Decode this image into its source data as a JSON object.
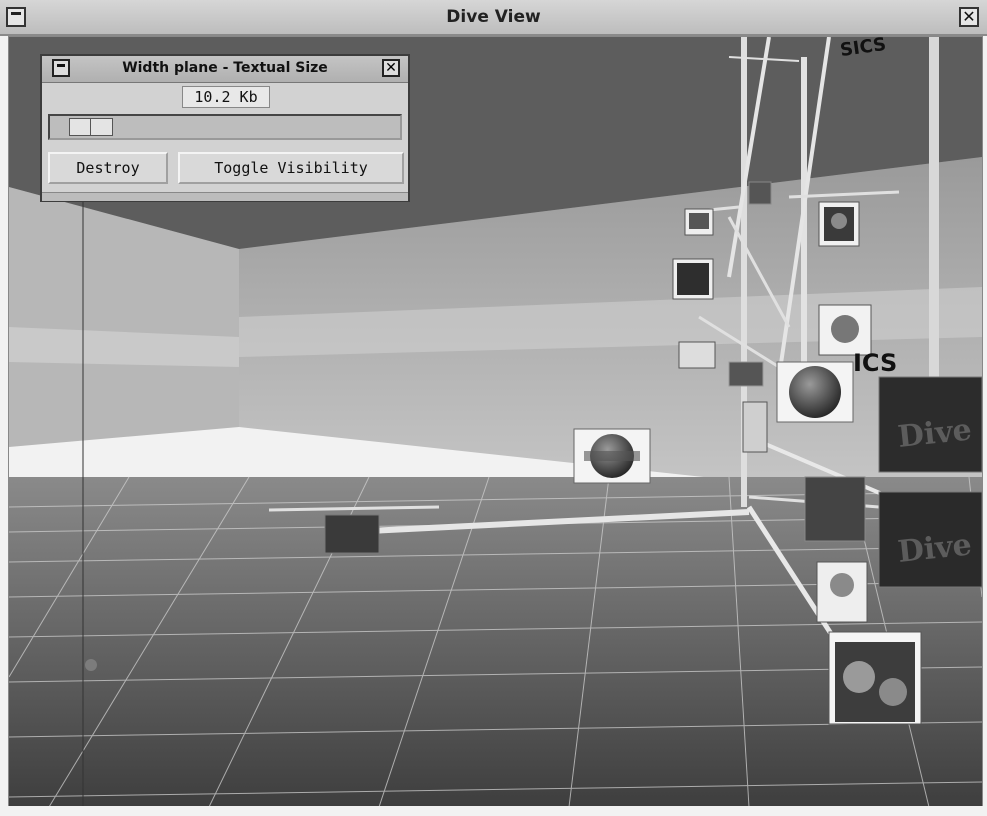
{
  "window": {
    "title": "Dive View",
    "close_glyph": "✕"
  },
  "dialog": {
    "title": "Width plane - Textual Size",
    "value": "10.2 Kb",
    "slider_level": 0.05,
    "destroy_label": "Destroy",
    "toggle_label": "Toggle Visibility",
    "close_glyph": "✕"
  },
  "scene": {
    "labels": [
      "SICS",
      "ICS"
    ],
    "icons": [
      "photo-frame-icon",
      "globe-icon",
      "signboard-icon"
    ]
  }
}
